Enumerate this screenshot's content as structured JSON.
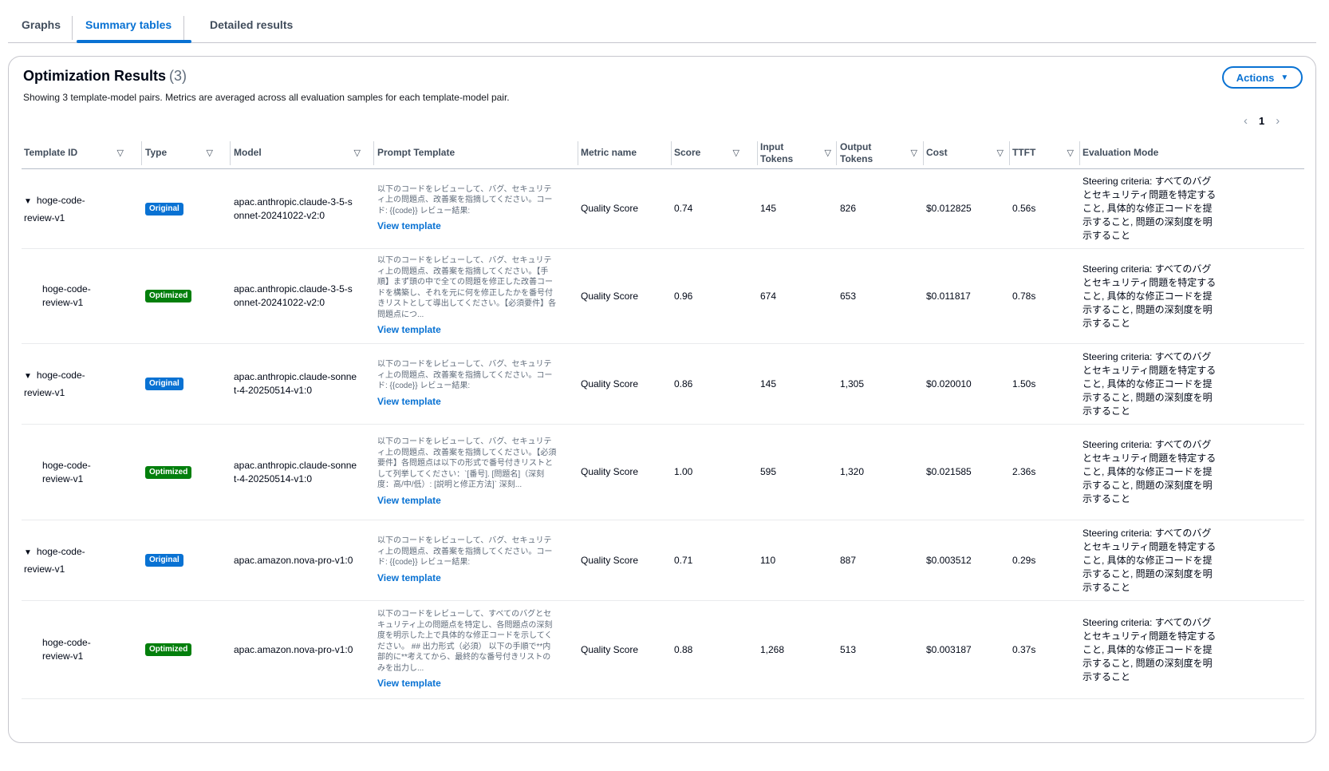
{
  "tabs": [
    "Graphs",
    "Summary tables",
    "Detailed results"
  ],
  "header": {
    "title": "Optimization Results",
    "count": "(3)",
    "description": "Showing 3 template-model pairs. Metrics are averaged across all evaluation samples for each template-model pair.",
    "actions_label": "Actions"
  },
  "pagination": {
    "current_page": "1"
  },
  "columns": [
    "Template ID",
    "Type",
    "Model",
    "Prompt Template",
    "Metric name",
    "Score",
    "Input Tokens",
    "Output Tokens",
    "Cost",
    "TTFT",
    "Evaluation Mode"
  ],
  "colors": {
    "accent": "#0972d3",
    "original_badge": "#0972d3",
    "optimized_badge": "#037f0c"
  },
  "rows": [
    {
      "template_id": "hoge-code-review-v1",
      "expandable": true,
      "type": "Original",
      "model": "apac.anthropic.claude-3-5-sonnet-20241022-v2:0",
      "prompt": "以下のコードをレビューして、バグ、セキュリティ上の問題点、改善案を指摘してください。コード: {{code}} レビュー結果:",
      "view_label": "View template",
      "metric": "Quality Score",
      "score": "0.74",
      "input_tokens": "145",
      "output_tokens": "826",
      "cost": "$0.012825",
      "ttft": "0.56s",
      "eval_mode": "Steering criteria: すべてのバグとセキュリティ問題を特定すること, 具体的な修正コードを提示すること, 問題の深刻度を明示すること"
    },
    {
      "template_id": "hoge-code-review-v1",
      "expandable": false,
      "type": "Optimized",
      "model": "apac.anthropic.claude-3-5-sonnet-20241022-v2:0",
      "prompt": "以下のコードをレビューして、バグ、セキュリティ上の問題点、改善案を指摘してください。【手順】まず頭の中で全ての問題を修正した改善コードを構築し、それを元に何を修正したかを番号付きリストとして導出してください。【必須要件】各問題点につ...",
      "view_label": "View template",
      "metric": "Quality Score",
      "score": "0.96",
      "input_tokens": "674",
      "output_tokens": "653",
      "cost": "$0.011817",
      "ttft": "0.78s",
      "eval_mode": "Steering criteria: すべてのバグとセキュリティ問題を特定すること, 具体的な修正コードを提示すること, 問題の深刻度を明示すること"
    },
    {
      "template_id": "hoge-code-review-v1",
      "expandable": true,
      "type": "Original",
      "model": "apac.anthropic.claude-sonnet-4-20250514-v1:0",
      "prompt": "以下のコードをレビューして、バグ、セキュリティ上の問題点、改善案を指摘してください。コード: {{code}} レビュー結果:",
      "view_label": "View template",
      "metric": "Quality Score",
      "score": "0.86",
      "input_tokens": "145",
      "output_tokens": "1,305",
      "cost": "$0.020010",
      "ttft": "1.50s",
      "eval_mode": "Steering criteria: すべてのバグとセキュリティ問題を特定すること, 具体的な修正コードを提示すること, 問題の深刻度を明示すること"
    },
    {
      "template_id": "hoge-code-review-v1",
      "expandable": false,
      "type": "Optimized",
      "model": "apac.anthropic.claude-sonnet-4-20250514-v1:0",
      "prompt": "以下のコードをレビューして、バグ、セキュリティ上の問題点、改善案を指摘してください。【必須要件】各問題点は以下の形式で番号付きリストとして列挙してください：`[番号]. [問題名]（深刻度：高/中/低）: [説明と修正方法]` 深刻...",
      "view_label": "View template",
      "metric": "Quality Score",
      "score": "1.00",
      "input_tokens": "595",
      "output_tokens": "1,320",
      "cost": "$0.021585",
      "ttft": "2.36s",
      "eval_mode": "Steering criteria: すべてのバグとセキュリティ問題を特定すること, 具体的な修正コードを提示すること, 問題の深刻度を明示すること"
    },
    {
      "template_id": "hoge-code-review-v1",
      "expandable": true,
      "type": "Original",
      "model": "apac.amazon.nova-pro-v1:0",
      "prompt": "以下のコードをレビューして、バグ、セキュリティ上の問題点、改善案を指摘してください。コード: {{code}} レビュー結果:",
      "view_label": "View template",
      "metric": "Quality Score",
      "score": "0.71",
      "input_tokens": "110",
      "output_tokens": "887",
      "cost": "$0.003512",
      "ttft": "0.29s",
      "eval_mode": "Steering criteria: すべてのバグとセキュリティ問題を特定すること, 具体的な修正コードを提示すること, 問題の深刻度を明示すること"
    },
    {
      "template_id": "hoge-code-review-v1",
      "expandable": false,
      "type": "Optimized",
      "model": "apac.amazon.nova-pro-v1:0",
      "prompt": "以下のコードをレビューして、すべてのバグとセキュリティ上の問題点を特定し、各問題点の深刻度を明示した上で具体的な修正コードを示してください。 ## 出力形式（必須） 以下の手順で**内部的に**考えてから、最終的な番号付きリストのみを出力し...",
      "view_label": "View template",
      "metric": "Quality Score",
      "score": "0.88",
      "input_tokens": "1,268",
      "output_tokens": "513",
      "cost": "$0.003187",
      "ttft": "0.37s",
      "eval_mode": "Steering criteria: すべてのバグとセキュリティ問題を特定すること, 具体的な修正コードを提示すること, 問題の深刻度を明示すること"
    }
  ]
}
